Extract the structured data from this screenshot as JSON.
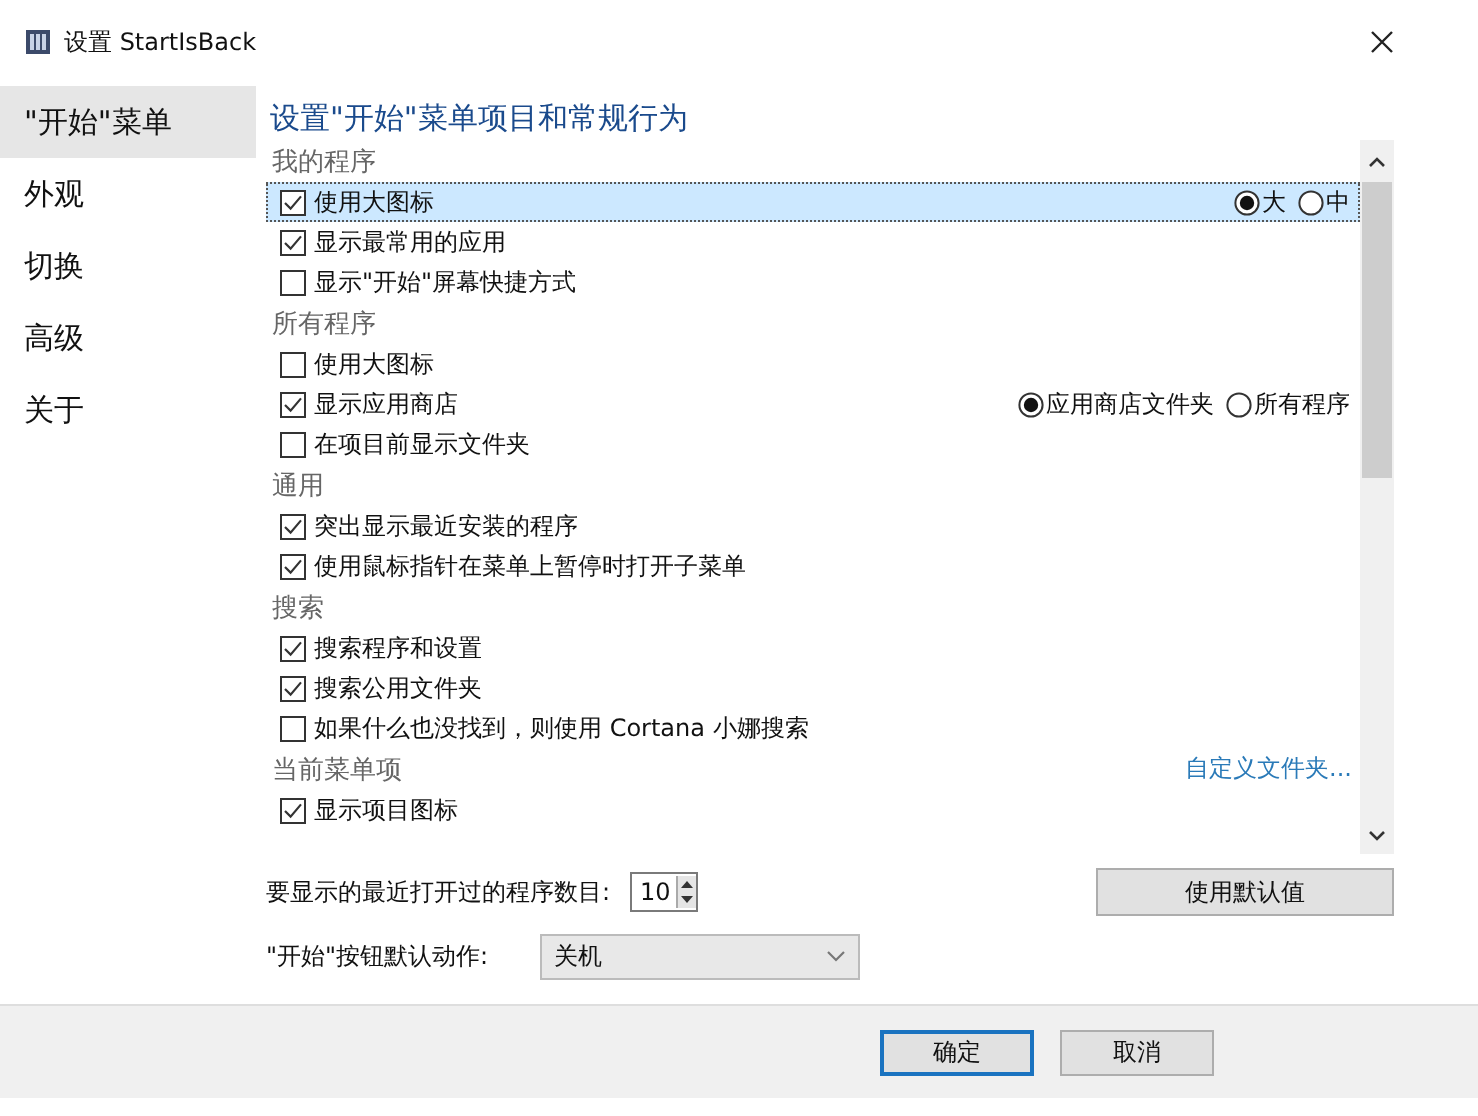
{
  "window": {
    "title": "设置 StartIsBack"
  },
  "sidebar": {
    "items": [
      {
        "label": "\"开始\"菜单",
        "selected": true
      },
      {
        "label": "外观",
        "selected": false
      },
      {
        "label": "切换",
        "selected": false
      },
      {
        "label": "高级",
        "selected": false
      },
      {
        "label": "关于",
        "selected": false
      }
    ]
  },
  "heading": "设置\"开始\"菜单项目和常规行为",
  "list": {
    "groups": [
      {
        "title": "我的程序",
        "items": [
          {
            "label": "使用大图标",
            "checked": true,
            "selected": true,
            "options": [
              {
                "label": "大",
                "selected": true
              },
              {
                "label": "中",
                "selected": false
              }
            ]
          },
          {
            "label": "显示最常用的应用",
            "checked": true,
            "selected": false
          },
          {
            "label": "显示\"开始\"屏幕快捷方式",
            "checked": false,
            "selected": false
          }
        ]
      },
      {
        "title": "所有程序",
        "items": [
          {
            "label": "使用大图标",
            "checked": false,
            "selected": false
          },
          {
            "label": "显示应用商店",
            "checked": true,
            "selected": false,
            "options": [
              {
                "label": "应用商店文件夹",
                "selected": true
              },
              {
                "label": "所有程序",
                "selected": false
              }
            ]
          },
          {
            "label": "在项目前显示文件夹",
            "checked": false,
            "selected": false
          }
        ]
      },
      {
        "title": "通用",
        "items": [
          {
            "label": "突出显示最近安装的程序",
            "checked": true,
            "selected": false
          },
          {
            "label": "使用鼠标指针在菜单上暂停时打开子菜单",
            "checked": true,
            "selected": false
          }
        ]
      },
      {
        "title": "搜索",
        "items": [
          {
            "label": "搜索程序和设置",
            "checked": true,
            "selected": false
          },
          {
            "label": "搜索公用文件夹",
            "checked": true,
            "selected": false
          },
          {
            "label": "如果什么也没找到，则使用 Cortana 小娜搜索",
            "checked": false,
            "selected": false
          }
        ]
      },
      {
        "title": "当前菜单项",
        "link": "自定义文件夹...",
        "items": [
          {
            "label": "显示项目图标",
            "checked": true,
            "selected": false
          }
        ]
      }
    ]
  },
  "recent": {
    "label": "要显示的最近打开过的程序数目:",
    "value": "10"
  },
  "default_button": "使用默认值",
  "start_action": {
    "label": "\"开始\"按钮默认动作:",
    "value": "关机"
  },
  "buttons": [
    {
      "label": "确定",
      "default": true
    },
    {
      "label": "取消",
      "default": false
    }
  ]
}
